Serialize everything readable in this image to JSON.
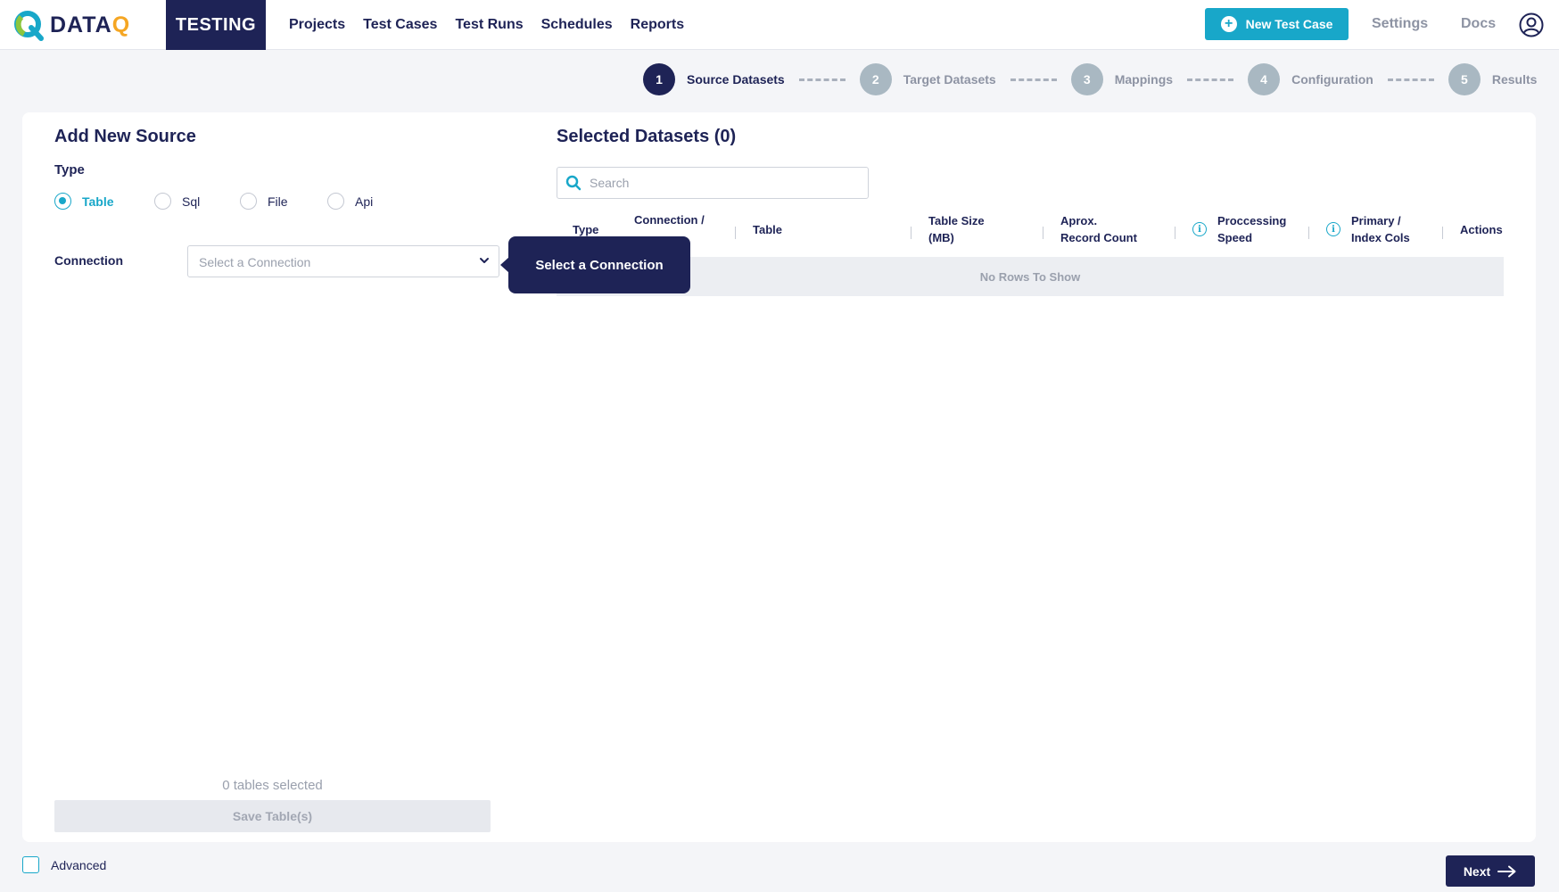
{
  "brand": {
    "logo_main": "DATA",
    "logo_accent": "Q",
    "app_badge": "TESTING"
  },
  "nav": {
    "items": [
      "Projects",
      "Test Cases",
      "Test Runs",
      "Schedules",
      "Reports"
    ]
  },
  "header": {
    "new_button_label": "New Test Case",
    "settings_label": "Settings",
    "docs_label": "Docs",
    "accent_color": "#18a7c9",
    "primary_color": "#1e2356"
  },
  "stepper": {
    "steps": [
      {
        "number": "1",
        "label": "Source Datasets",
        "active": true
      },
      {
        "number": "2",
        "label": "Target Datasets",
        "active": false
      },
      {
        "number": "3",
        "label": "Mappings",
        "active": false
      },
      {
        "number": "4",
        "label": "Configuration",
        "active": false
      },
      {
        "number": "5",
        "label": "Results",
        "active": false
      }
    ]
  },
  "source_panel": {
    "title": "Add New Source",
    "type_label": "Type",
    "type_options": [
      "Table",
      "Sql",
      "File",
      "Api"
    ],
    "selected_type": "Table",
    "connection_label": "Connection",
    "connection_placeholder": "Select a Connection",
    "tooltip": "Select a Connection",
    "tables_selected": "0 tables selected",
    "save_button": "Save Table(s)"
  },
  "datasets_panel": {
    "title": "Selected Datasets (0)",
    "search_placeholder": "Search",
    "columns": {
      "type": "Type",
      "connection": "Connection /",
      "table": "Table",
      "table_size_1": "Table Size",
      "table_size_2": "(MB)",
      "record_count_1": "Aprox.",
      "record_count_2": "Record Count",
      "speed_1": "Proccessing",
      "speed_2": "Speed",
      "primary_1": "Primary /",
      "primary_2": "Index Cols",
      "actions": "Actions"
    },
    "empty_message": "No Rows To Show"
  },
  "footer": {
    "advanced_label": "Advanced",
    "next_label": "Next"
  }
}
